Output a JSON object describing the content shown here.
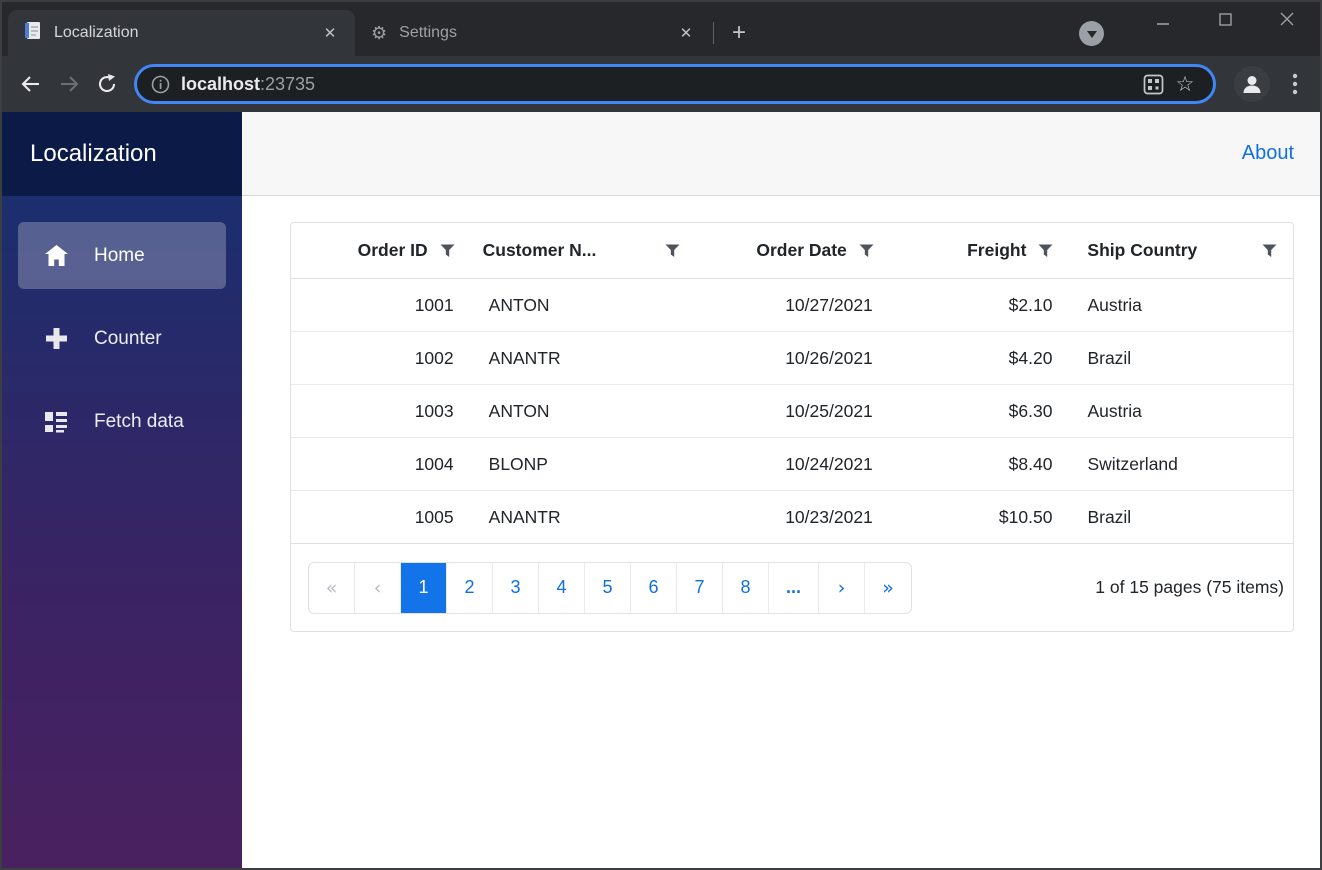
{
  "browser": {
    "tabs": [
      {
        "title": "Localization",
        "favicon": "document"
      },
      {
        "title": "Settings",
        "favicon": "gear"
      }
    ],
    "new_tab_label": "+",
    "url": {
      "host": "localhost",
      "port": ":23735"
    },
    "gear_glyph": "⚙",
    "star_glyph": "☆"
  },
  "app": {
    "brand": "Localization",
    "nav": [
      {
        "label": "Home",
        "icon": "home-icon",
        "active": true
      },
      {
        "label": "Counter",
        "icon": "plus-icon",
        "active": false
      },
      {
        "label": "Fetch data",
        "icon": "list-icon",
        "active": false
      }
    ],
    "about_label": "About"
  },
  "grid": {
    "columns": [
      {
        "label": "Order ID",
        "align": "right",
        "filterable": true
      },
      {
        "label": "Customer N...",
        "align": "left",
        "filterable": true
      },
      {
        "label": "Order Date",
        "align": "right",
        "filterable": true
      },
      {
        "label": "Freight",
        "align": "right",
        "filterable": true
      },
      {
        "label": "Ship Country",
        "align": "left",
        "filterable": true
      }
    ],
    "rows": [
      [
        "1001",
        "ANTON",
        "10/27/2021",
        "$2.10",
        "Austria"
      ],
      [
        "1002",
        "ANANTR",
        "10/26/2021",
        "$4.20",
        "Brazil"
      ],
      [
        "1003",
        "ANTON",
        "10/25/2021",
        "$6.30",
        "Austria"
      ],
      [
        "1004",
        "BLONP",
        "10/24/2021",
        "$8.40",
        "Switzerland"
      ],
      [
        "1005",
        "ANANTR",
        "10/23/2021",
        "$10.50",
        "Brazil"
      ]
    ],
    "pager": {
      "first": "«",
      "prev": "‹",
      "pages": [
        "1",
        "2",
        "3",
        "4",
        "5",
        "6",
        "7",
        "8"
      ],
      "ellipsis": "...",
      "next": "›",
      "last": "»",
      "active_page": "1",
      "info": "1 of 15 pages (75 items)"
    }
  },
  "colors": {
    "focus_ring": "#4285f4",
    "link_blue": "#0f6fe5",
    "active_page_bg": "#1274e8",
    "sidebar_header": "#0c1a48",
    "sidebar_gradient_top": "#1b2e6e",
    "sidebar_gradient_bottom": "#4a2160",
    "toprow_bg": "#f7f7f7"
  }
}
